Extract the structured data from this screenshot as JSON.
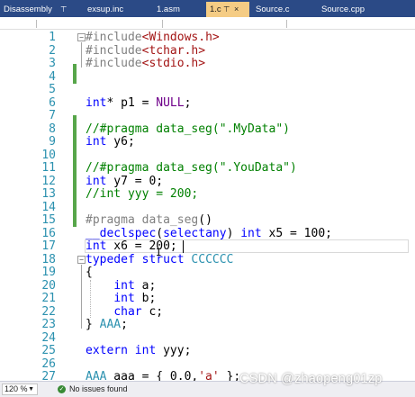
{
  "tabs": [
    {
      "label": "Disassembly",
      "pin": "⊤"
    },
    {
      "label": "exsup.inc"
    },
    {
      "label": "1.asm"
    },
    {
      "label": "1.c",
      "pin": "⊤",
      "close": "×",
      "active": true
    },
    {
      "label": "Source.c"
    },
    {
      "label": "Source.cpp"
    }
  ],
  "editor": {
    "line_numbers": [
      "1",
      "2",
      "3",
      "4",
      "5",
      "6",
      "7",
      "8",
      "9",
      "10",
      "11",
      "12",
      "13",
      "14",
      "15",
      "16",
      "17",
      "18",
      "19",
      "20",
      "21",
      "22",
      "23",
      "24",
      "25",
      "26",
      "27"
    ],
    "lines": [
      [
        {
          "t": "#include",
          "c": "pp"
        },
        {
          "t": "<Windows.h>",
          "c": "str"
        }
      ],
      [
        {
          "t": "#include",
          "c": "pp"
        },
        {
          "t": "<tchar.h>",
          "c": "str"
        }
      ],
      [
        {
          "t": "#include",
          "c": "pp"
        },
        {
          "t": "<stdio.h>",
          "c": "str"
        }
      ],
      [],
      [],
      [
        {
          "t": "int",
          "c": "kw"
        },
        {
          "t": "* p1 = "
        },
        {
          "t": "NULL",
          "c": "mac"
        },
        {
          "t": ";"
        }
      ],
      [],
      [
        {
          "t": "//#pragma data_seg(\".MyData\")",
          "c": "cm"
        }
      ],
      [
        {
          "t": "int",
          "c": "kw"
        },
        {
          "t": " y6;"
        }
      ],
      [],
      [
        {
          "t": "//#pragma data_seg(\".YouData\")",
          "c": "cm"
        }
      ],
      [
        {
          "t": "int",
          "c": "kw"
        },
        {
          "t": " y7 = 0;"
        }
      ],
      [
        {
          "t": "//int yyy = 200;",
          "c": "cm"
        }
      ],
      [],
      [
        {
          "t": "#pragma",
          "c": "pp"
        },
        {
          "t": " "
        },
        {
          "t": "data_seg",
          "c": "pp"
        },
        {
          "t": "()"
        }
      ],
      [
        {
          "t": "__declspec",
          "c": "kw"
        },
        {
          "t": "("
        },
        {
          "t": "selectany",
          "c": "kw"
        },
        {
          "t": ") "
        },
        {
          "t": "int",
          "c": "kw"
        },
        {
          "t": " x5 = 100;"
        }
      ],
      [
        {
          "t": "int",
          "c": "kw"
        },
        {
          "t": " x6 = 200;"
        }
      ],
      [
        {
          "t": "typedef",
          "c": "kw"
        },
        {
          "t": " "
        },
        {
          "t": "struct",
          "c": "kw"
        },
        {
          "t": " "
        },
        {
          "t": "CCCCCC",
          "c": "typ"
        }
      ],
      [
        {
          "t": "{"
        }
      ],
      [
        {
          "t": "    "
        },
        {
          "t": "int",
          "c": "kw"
        },
        {
          "t": " a;"
        }
      ],
      [
        {
          "t": "    "
        },
        {
          "t": "int",
          "c": "kw"
        },
        {
          "t": " b;"
        }
      ],
      [
        {
          "t": "    "
        },
        {
          "t": "char",
          "c": "kw"
        },
        {
          "t": " c;"
        }
      ],
      [
        {
          "t": "} "
        },
        {
          "t": "AAA",
          "c": "typ"
        },
        {
          "t": ";"
        }
      ],
      [],
      [
        {
          "t": "extern",
          "c": "kw"
        },
        {
          "t": " "
        },
        {
          "t": "int",
          "c": "kw"
        },
        {
          "t": " yyy;"
        }
      ],
      [],
      [
        {
          "t": "AAA",
          "c": "typ"
        },
        {
          "t": " aaa = { 0.0,"
        },
        {
          "t": "'a'",
          "c": "str"
        },
        {
          "t": " };"
        }
      ]
    ],
    "fold_collapse_glyph": "−",
    "ibeam_glyph": "I"
  },
  "statusbar": {
    "zoom": "120 %",
    "zoom_dropdown_icon": "chevron-down-icon",
    "issues_icon": "checkmark-circle-icon",
    "issues_glyph": "✓",
    "issues_text": "No issues found"
  },
  "watermark": "CSDN @zhaopeng01zp",
  "colors": {
    "tabbar": "#2b4a86",
    "active_tab": "#f5cc84",
    "keyword": "#0000ff",
    "preprocessor": "#808080",
    "string": "#a31515",
    "comment": "#008000",
    "macro": "#6f008a",
    "type": "#2b91af",
    "line_number": "#2b91af",
    "change_bar": "#57a64a"
  }
}
